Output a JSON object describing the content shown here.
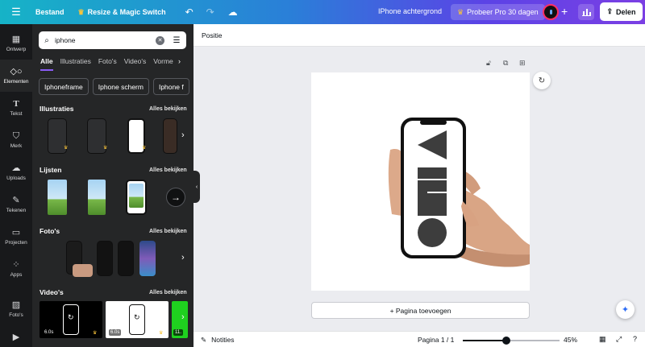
{
  "topbar": {
    "menu_icon": "hamburger-icon",
    "file_label": "Bestand",
    "resize_label": "Resize & Magic Switch",
    "doc_title": "IPhone achtergrond",
    "pro_label": "Probeer Pro 30 dagen",
    "share_label": "Delen",
    "accent_gradient": [
      "#16b3c7",
      "#2a7fd8",
      "#5b43e6",
      "#7b3fe4"
    ]
  },
  "rail": {
    "items": [
      {
        "label": "Ontwerp",
        "icon": "design-grid-icon"
      },
      {
        "label": "Elementen",
        "icon": "elements-shapes-icon"
      },
      {
        "label": "Tekst",
        "icon": "text-icon"
      },
      {
        "label": "Merk",
        "icon": "brand-icon"
      },
      {
        "label": "Uploads",
        "icon": "cloud-upload-icon"
      },
      {
        "label": "Tekenen",
        "icon": "pen-draw-icon"
      },
      {
        "label": "Projecten",
        "icon": "folder-icon"
      },
      {
        "label": "Apps",
        "icon": "apps-grid-icon"
      },
      {
        "label": "Foto's",
        "icon": "photo-icon"
      },
      {
        "label": "",
        "icon": "video-icon"
      }
    ]
  },
  "panel": {
    "search": {
      "value": "iphone",
      "placeholder": ""
    },
    "tabs": [
      "Alle",
      "Illustraties",
      "Foto's",
      "Video's",
      "Vorme"
    ],
    "chips": [
      "Iphoneframe",
      "Iphone scherm",
      "Iphone f"
    ],
    "see_all": "Alles bekijken",
    "sections": {
      "illustraties": "Illustraties",
      "lijsten": "Lijsten",
      "fotos": "Foto's",
      "videos": "Video's"
    },
    "video_durations": [
      "6.0s",
      "6.0s",
      "11."
    ]
  },
  "context_bar": {
    "position_label": "Positie"
  },
  "canvas": {
    "add_page_label": "+ Pagina toevoegen",
    "page_background": "#ffffff"
  },
  "bottombar": {
    "notes_label": "Notities",
    "page_indicator": "Pagina 1 / 1",
    "zoom": "45%",
    "zoom_fraction": 0.45
  }
}
